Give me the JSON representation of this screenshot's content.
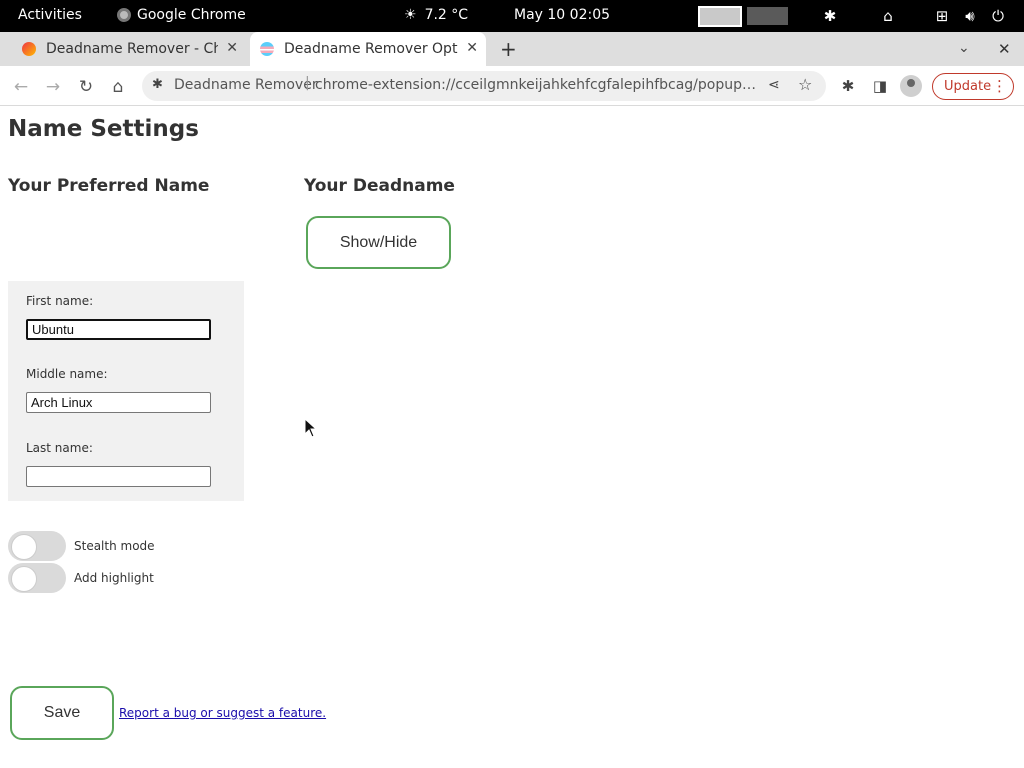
{
  "system_bar": {
    "activities": "Activities",
    "app_name": "Google Chrome",
    "weather": "7.2 °C",
    "clock": "May 10  02:05"
  },
  "tabs": [
    {
      "title": "Deadname Remover - Chr",
      "active": false
    },
    {
      "title": "Deadname Remover Optic",
      "active": true
    }
  ],
  "omnibox": {
    "origin": "Deadname Remover",
    "url": "chrome-extension://cceilgmnkeijahkehfcgfalepihfbcag/popup/option..."
  },
  "toolbar": {
    "update_label": "Update"
  },
  "page": {
    "title": "Name Settings",
    "preferred_heading": "Your Preferred Name",
    "deadname_heading": "Your Deadname",
    "show_hide_label": "Show/Hide",
    "fields": {
      "first_label": "First name:",
      "first_value": "Ubuntu",
      "middle_label": "Middle name:",
      "middle_value": "Arch Linux",
      "last_label": "Last name:",
      "last_value": ""
    },
    "toggles": {
      "stealth_label": "Stealth mode",
      "stealth_on": false,
      "highlight_label": "Add highlight",
      "highlight_on": false
    },
    "save_label": "Save",
    "report_link": "Report a bug or suggest a feature."
  },
  "colors": {
    "accent_green": "#5aa65a",
    "update_red": "#c0392b",
    "link_blue": "#1a0dab"
  }
}
